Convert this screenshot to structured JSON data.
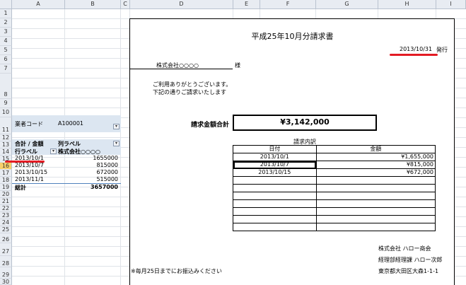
{
  "columns": [
    "A",
    "B",
    "C",
    "D",
    "E",
    "F",
    "G",
    "H",
    "I"
  ],
  "rows": [
    "1",
    "2",
    "3",
    "4",
    "5",
    "6",
    "7",
    "8",
    "9",
    "10",
    "11",
    "12",
    "13",
    "14",
    "15",
    "16",
    "17",
    "18",
    "19",
    "20",
    "21",
    "22",
    "23",
    "24",
    "25",
    "26",
    "27",
    "28",
    "29",
    "30"
  ],
  "pivot": {
    "filter_label": "業者コード",
    "filter_value": "A100001",
    "data_label": "合計 / 金額",
    "col_label": "列ラベル",
    "row_label": "行ラベル",
    "col_value": "株式会社○○○○",
    "rows": [
      {
        "date": "2013/10/1",
        "amount": "1655000"
      },
      {
        "date": "2013/10/7",
        "amount": "815000"
      },
      {
        "date": "2013/10/15",
        "amount": "672000"
      },
      {
        "date": "2013/11/1",
        "amount": "515000"
      }
    ],
    "total_label": "総計",
    "total_value": "3657000"
  },
  "invoice": {
    "title": "平成25年10月分請求書",
    "issue_date": "2013/10/31",
    "issue_suffix": "発行",
    "customer": "株式会社○○○○",
    "honorific": "様",
    "greeting1": "ご利用ありがとうございます。",
    "greeting2": "下記の通りご請求いたします",
    "total_label": "請求金額合計",
    "total_amount": "¥3,142,000",
    "details_title": "請求内訳",
    "col_date": "日付",
    "col_amount": "金額",
    "items": [
      {
        "date": "2013/10/1",
        "amount": "¥1,655,000"
      },
      {
        "date": "2013/10/7",
        "amount": "¥815,000"
      },
      {
        "date": "2013/10/15",
        "amount": "¥672,000"
      }
    ],
    "company": "株式会社 ハロー商会",
    "department": "経理部経理課 ハロー次郎",
    "address": "東京都大田区大森1-1-1",
    "note": "※毎月25日までにお振込みください"
  },
  "colors": {
    "highlight": "#e31b23",
    "header_bg": "#e8ecf2",
    "pivot_bg": "#dce6f1"
  }
}
